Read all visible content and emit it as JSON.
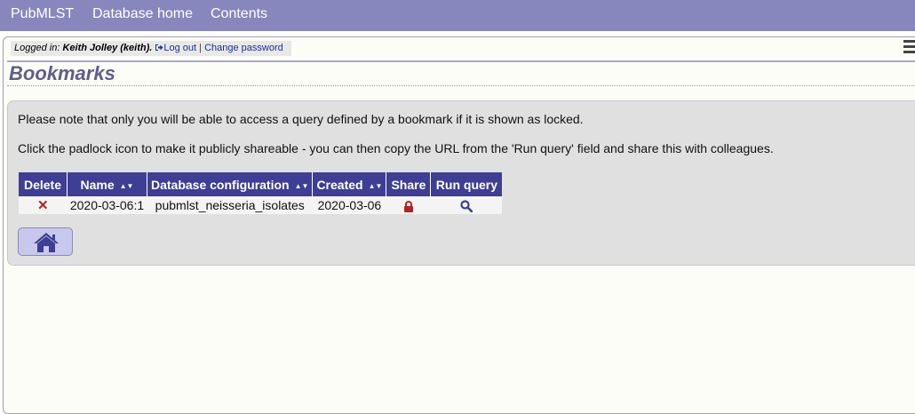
{
  "nav": {
    "items": [
      "PubMLST",
      "Database home",
      "Contents"
    ]
  },
  "login": {
    "prefix": "Logged in:",
    "user": "Keith Jolley (keith).",
    "logout": "Log out",
    "separator": "|",
    "change_password": "Change password"
  },
  "page": {
    "title": "Bookmarks"
  },
  "notes": [
    "Please note that only you will be able to access a query defined by a bookmark if it is shown as locked.",
    "Click the padlock icon to make it publicly shareable - you can then copy the URL from the 'Run query' field and share this with colleagues."
  ],
  "table": {
    "headers": [
      "Delete",
      "Name",
      "Database configuration",
      "Created",
      "Share",
      "Run query"
    ],
    "rows": [
      {
        "delete_icon": "close-icon",
        "name": "2020-03-06:1",
        "database": "pubmlst_neisseria_isolates",
        "created": "2020-03-06",
        "share_icon": "padlock-locked-icon",
        "run_icon": "search-icon"
      }
    ]
  },
  "home_button": {
    "icon": "home-icon"
  },
  "colors": {
    "nav_bg": "#8787bd",
    "title": "#5e5e8a",
    "table_header": "#3e3e94",
    "delete": "#b22222",
    "lock": "#b22222",
    "search": "#3e3e94"
  }
}
